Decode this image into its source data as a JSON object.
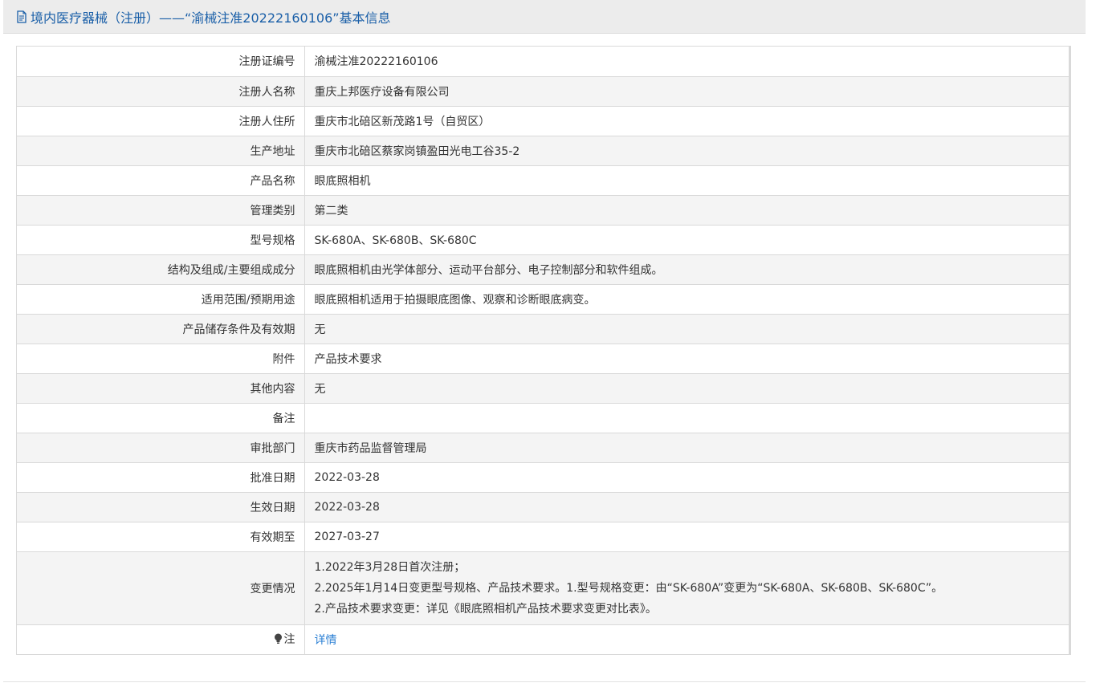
{
  "header": {
    "title": "境内医疗器械（注册）——“渝械注准20222160106”基本信息",
    "icon": "document-icon"
  },
  "rows": [
    {
      "label": "注册证编号",
      "value": "渝械注准20222160106"
    },
    {
      "label": "注册人名称",
      "value": "重庆上邦医疗设备有限公司"
    },
    {
      "label": "注册人住所",
      "value": "重庆市北碚区新茂路1号（自贸区）"
    },
    {
      "label": "生产地址",
      "value": "重庆市北碚区蔡家岗镇盈田光电工谷35-2"
    },
    {
      "label": "产品名称",
      "value": "眼底照相机"
    },
    {
      "label": "管理类别",
      "value": "第二类"
    },
    {
      "label": "型号规格",
      "value": "SK-680A、SK-680B、SK-680C"
    },
    {
      "label": "结构及组成/主要组成成分",
      "value": "眼底照相机由光学体部分、运动平台部分、电子控制部分和软件组成。"
    },
    {
      "label": "适用范围/预期用途",
      "value": "眼底照相机适用于拍摄眼底图像、观察和诊断眼底病变。"
    },
    {
      "label": "产品储存条件及有效期",
      "value": "无"
    },
    {
      "label": "附件",
      "value": "产品技术要求"
    },
    {
      "label": "其他内容",
      "value": "无"
    },
    {
      "label": "备注",
      "value": ""
    },
    {
      "label": "审批部门",
      "value": "重庆市药品监督管理局"
    },
    {
      "label": "批准日期",
      "value": "2022-03-28"
    },
    {
      "label": "生效日期",
      "value": "2022-03-28"
    },
    {
      "label": "有效期至",
      "value": "2027-03-27"
    }
  ],
  "change": {
    "label": "变更情况",
    "lines": [
      "1.2022年3月28日首次注册；",
      "2.2025年1月14日变更型号规格、产品技术要求。1.型号规格变更：由“SK-680A”变更为“SK-680A、SK-680B、SK-680C”。",
      "2.产品技术要求变更：详见《眼底照相机产品技术要求变更对比表》。"
    ]
  },
  "note": {
    "label": "注",
    "link": "详情",
    "icon": "lightbulb-icon"
  },
  "colors": {
    "title": "#1a5fa8",
    "link": "#2a7fd4",
    "stripe": "#f4f4f4",
    "border": "#d9d9d9"
  }
}
